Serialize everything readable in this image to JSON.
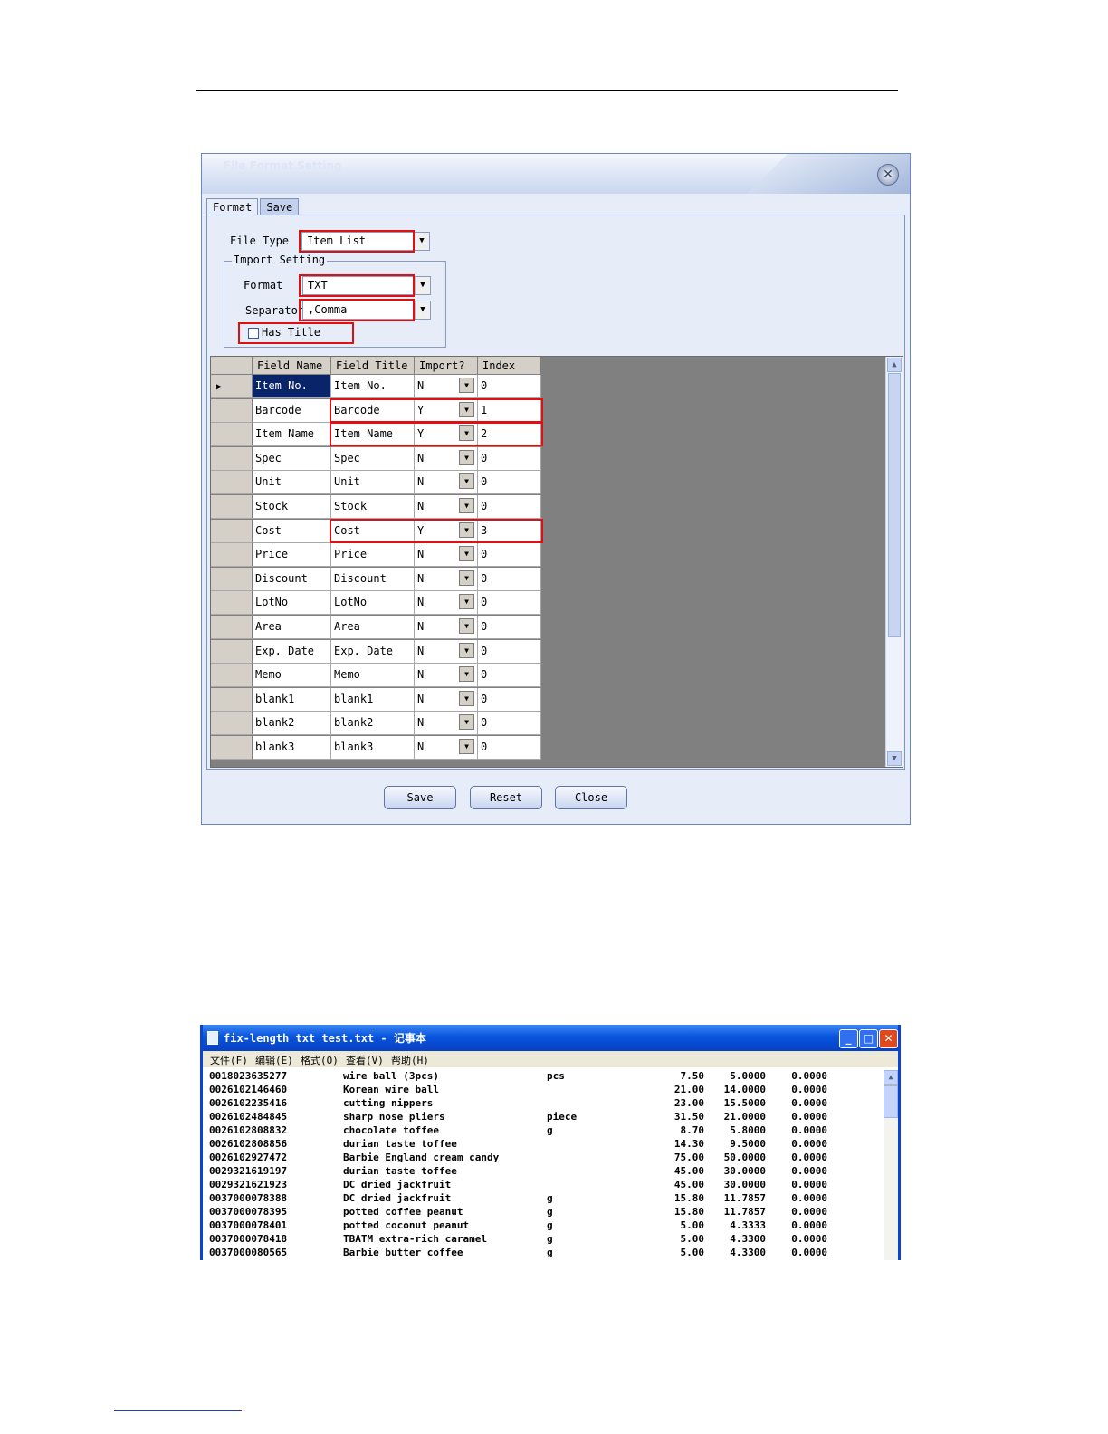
{
  "dialog": {
    "title": "File Format Setting",
    "close_glyph": "✕",
    "tabs": [
      "Format",
      "Save"
    ],
    "file_type": {
      "label": "File Type",
      "value": "Item List"
    },
    "import_setting": {
      "legend": "Import Setting",
      "format": {
        "label": "Format",
        "value": "TXT"
      },
      "separator": {
        "label": "Separator",
        "value": ",Comma"
      },
      "has_title": {
        "label": "Has Title",
        "checked": false
      }
    },
    "grid": {
      "headers": [
        "Field Name",
        "Field Title",
        "Import?",
        "Index"
      ],
      "rows": [
        {
          "field_name": "Item No.",
          "field_title": "Item No.",
          "import": "N",
          "index": "0",
          "current": true
        },
        {
          "field_name": "Barcode",
          "field_title": "Barcode",
          "import": "Y",
          "index": "1"
        },
        {
          "field_name": "Item Name",
          "field_title": "Item Name",
          "import": "Y",
          "index": "2"
        },
        {
          "field_name": "Spec",
          "field_title": "Spec",
          "import": "N",
          "index": "0"
        },
        {
          "field_name": "Unit",
          "field_title": "Unit",
          "import": "N",
          "index": "0"
        },
        {
          "field_name": "Stock",
          "field_title": "Stock",
          "import": "N",
          "index": "0"
        },
        {
          "field_name": "Cost",
          "field_title": "Cost",
          "import": "Y",
          "index": "3"
        },
        {
          "field_name": "Price",
          "field_title": "Price",
          "import": "N",
          "index": "0"
        },
        {
          "field_name": "Discount",
          "field_title": "Discount",
          "import": "N",
          "index": "0"
        },
        {
          "field_name": "LotNo",
          "field_title": "LotNo",
          "import": "N",
          "index": "0"
        },
        {
          "field_name": "Area",
          "field_title": "Area",
          "import": "N",
          "index": "0"
        },
        {
          "field_name": "Exp. Date",
          "field_title": "Exp. Date",
          "import": "N",
          "index": "0"
        },
        {
          "field_name": "Memo",
          "field_title": "Memo",
          "import": "N",
          "index": "0"
        },
        {
          "field_name": "blank1",
          "field_title": "blank1",
          "import": "N",
          "index": "0"
        },
        {
          "field_name": "blank2",
          "field_title": "blank2",
          "import": "N",
          "index": "0"
        },
        {
          "field_name": "blank3",
          "field_title": "blank3",
          "import": "N",
          "index": "0"
        }
      ]
    },
    "buttons": {
      "save": "Save",
      "reset": "Reset",
      "close": "Close"
    },
    "highlight_color": "#e01010"
  },
  "notepad": {
    "title": "fix-length txt test.txt - 记事本",
    "menu": [
      "文件(F)",
      "编辑(E)",
      "格式(O)",
      "查看(V)",
      "帮助(H)"
    ],
    "lines": [
      [
        "0018023635277",
        "wire ball (3pcs)",
        "pcs",
        "7.50",
        "5.0000",
        "0.0000"
      ],
      [
        "0026102146460",
        "Korean wire ball",
        "",
        "21.00",
        "14.0000",
        "0.0000"
      ],
      [
        "0026102235416",
        "cutting nippers",
        "",
        "23.00",
        "15.5000",
        "0.0000"
      ],
      [
        "0026102484845",
        "sharp nose pliers",
        "piece",
        "31.50",
        "21.0000",
        "0.0000"
      ],
      [
        "0026102808832",
        "chocolate toffee",
        "g",
        "8.70",
        "5.8000",
        "0.0000"
      ],
      [
        "0026102808856",
        "durian taste toffee",
        "",
        "14.30",
        "9.5000",
        "0.0000"
      ],
      [
        "0026102927472",
        "Barbie England cream candy",
        "",
        "75.00",
        "50.0000",
        "0.0000"
      ],
      [
        "0029321619197",
        "durian taste toffee",
        "",
        "45.00",
        "30.0000",
        "0.0000"
      ],
      [
        "0029321621923",
        "DC dried jackfruit",
        "",
        "45.00",
        "30.0000",
        "0.0000"
      ],
      [
        "0037000078388",
        "DC dried jackfruit",
        "g",
        "15.80",
        "11.7857",
        "0.0000"
      ],
      [
        "0037000078395",
        "potted coffee peanut",
        "g",
        "15.80",
        "11.7857",
        "0.0000"
      ],
      [
        "0037000078401",
        "potted coconut peanut",
        "g",
        "5.00",
        "4.3333",
        "0.0000"
      ],
      [
        "0037000078418",
        "TBATM extra-rich caramel",
        "g",
        "5.00",
        "4.3300",
        "0.0000"
      ],
      [
        "0037000080565",
        "Barbie butter coffee",
        "g",
        "5.00",
        "4.3300",
        "0.0000"
      ]
    ]
  }
}
